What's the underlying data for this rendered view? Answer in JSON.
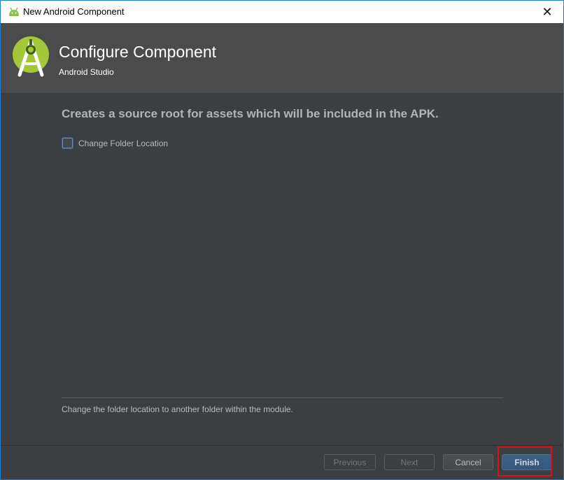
{
  "window": {
    "title": "New Android Component",
    "close_glyph": "✕"
  },
  "header": {
    "title": "Configure Component",
    "subtitle": "Android Studio"
  },
  "main": {
    "description": "Creates a source root for assets which will be included in the APK.",
    "checkbox": {
      "label": "Change Folder Location",
      "checked": false
    },
    "help_text": "Change the folder location to another folder within the module."
  },
  "footer": {
    "previous_label": "Previous",
    "next_label": "Next",
    "cancel_label": "Cancel",
    "finish_label": "Finish"
  },
  "colors": {
    "background": "#3c3f41",
    "header_bg": "#4b4b4b",
    "android_green": "#a4c639",
    "primary_button": "#365880",
    "highlight": "#e0101a"
  },
  "icons": {
    "app": "android-icon",
    "logo": "android-studio-logo-icon",
    "close": "close-icon"
  }
}
